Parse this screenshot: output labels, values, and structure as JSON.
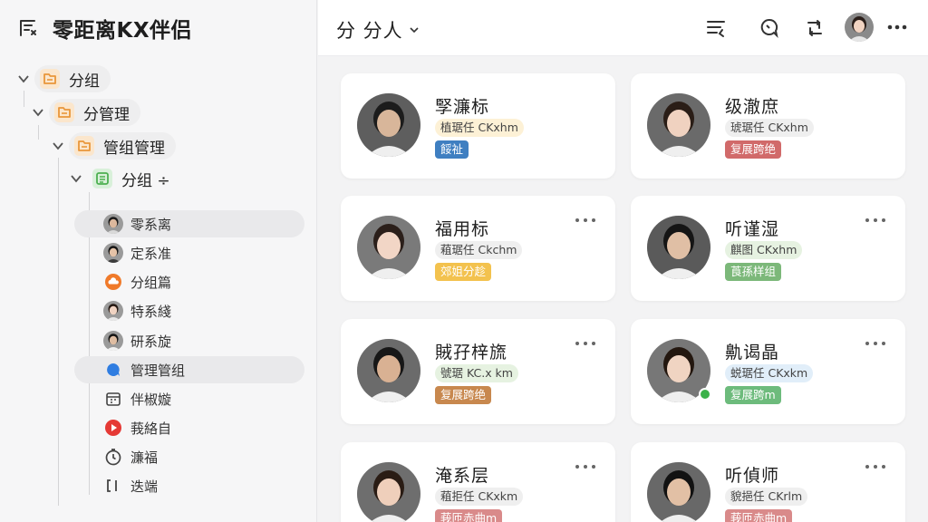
{
  "app": {
    "title": "零距离KX伴侣",
    "icon": "list-filter-icon"
  },
  "sidebar": {
    "tree": [
      {
        "label": "分组",
        "icon": "folder-icon",
        "color": "#e9963a",
        "bg": "#fbe6cc"
      },
      {
        "label": "分管理",
        "icon": "folder-icon",
        "color": "#e9963a",
        "bg": "#fbe6cc"
      },
      {
        "label": "管组管理",
        "icon": "folder-icon",
        "color": "#e9963a",
        "bg": "#fbe6cc"
      },
      {
        "label": "分组 ÷",
        "icon": "list-icon",
        "color": "#4caf50",
        "bg": "#d9f0da"
      }
    ],
    "sub_caption": "",
    "members": [
      {
        "label": "零系离",
        "kind": "avatar",
        "selected": true
      },
      {
        "label": "定系准",
        "kind": "avatar",
        "selected": false
      },
      {
        "label": "分组篇",
        "kind": "cloud-icon",
        "color": "#f07a2a",
        "selected": false
      },
      {
        "label": "特系綫",
        "kind": "avatar",
        "selected": false
      },
      {
        "label": "研系旋",
        "kind": "avatar",
        "selected": false
      },
      {
        "label": "管理管组",
        "kind": "chat-icon",
        "color": "#2f7de1",
        "selected": true
      },
      {
        "label": "伴椒嫙",
        "kind": "calendar-icon",
        "color": "#444",
        "selected": false
      },
      {
        "label": "莪絡自",
        "kind": "play-icon",
        "color": "#e53935",
        "selected": false
      },
      {
        "label": "濂福",
        "kind": "timer-icon",
        "color": "#444",
        "selected": false
      },
      {
        "label": "迭端",
        "kind": "bracket-icon",
        "color": "#444",
        "selected": false
      }
    ]
  },
  "topbar": {
    "scope_label": "分 分人",
    "icons": [
      "sort-list-icon",
      "chat-bubble-icon",
      "refresh-chat-icon",
      "user-avatar",
      "more-icon"
    ]
  },
  "cards": [
    {
      "name": "孯濂标",
      "sub": "植琚任 CKxhm",
      "sub_bg": "#fdf1d6",
      "tag": "餒祉",
      "tag_bg": "#3f7fc1",
      "more": false,
      "online": false,
      "avatar_bg": "#5e5e5e",
      "skin": "#d8b69a",
      "hair": "#1c1c1c"
    },
    {
      "name": "级澈庶",
      "sub": "琥琚任 CKxhm",
      "sub_bg": "#efefef",
      "tag": "复展跨绝",
      "tag_bg": "#d16a6a",
      "more": false,
      "online": false,
      "avatar_bg": "#6a6a6a",
      "skin": "#f0d2c0",
      "hair": "#2a1d16"
    },
    {
      "name": "福用标",
      "sub": "蒩琚任 Ckchm",
      "sub_bg": "#efefef",
      "tag": "郊姐分趁",
      "tag_bg": "#f3c24e",
      "more": true,
      "online": false,
      "avatar_bg": "#7a7a7a",
      "skin": "#f2d6c6",
      "hair": "#2b1f1a"
    },
    {
      "name": "听谨湿",
      "sub": "麒图 CKxhm",
      "sub_bg": "#e6f2e1",
      "tag": "莨孫样组",
      "tag_bg": "#7cb87a",
      "more": true,
      "online": false,
      "avatar_bg": "#5a5a5a",
      "skin": "#e0bfa5",
      "hair": "#151515"
    },
    {
      "name": "賊孖梓旒",
      "sub": "號琚 KC.x km",
      "sub_bg": "#e6f2e1",
      "tag": "复展跨绝",
      "tag_bg": "#c8884e",
      "more": true,
      "online": false,
      "avatar_bg": "#6b6b6b",
      "skin": "#d9b193",
      "hair": "#171717"
    },
    {
      "name": "鼽谒晶",
      "sub": "蜕琚任 CKxkm",
      "sub_bg": "#e1eef9",
      "tag": "复展跨m",
      "tag_bg": "#6dbb7c",
      "more": true,
      "online": true,
      "avatar_bg": "#777777",
      "skin": "#f0d4c2",
      "hair": "#23170f"
    },
    {
      "name": "淹系层",
      "sub": "蒩拒任 CKxkm",
      "sub_bg": "#efefef",
      "tag": "莪匝赤曲m",
      "tag_bg": "#d98a8a",
      "more": true,
      "online": false,
      "avatar_bg": "#6e6e6e",
      "skin": "#efcfbb",
      "hair": "#2a1c14"
    },
    {
      "name": "听偵师",
      "sub": "貌挹任 CKrlm",
      "sub_bg": "#efefef",
      "tag": "莪匝赤曲m",
      "tag_bg": "#d98a8a",
      "more": true,
      "online": false,
      "avatar_bg": "#686868",
      "skin": "#e2c0a5",
      "hair": "#121212"
    }
  ]
}
